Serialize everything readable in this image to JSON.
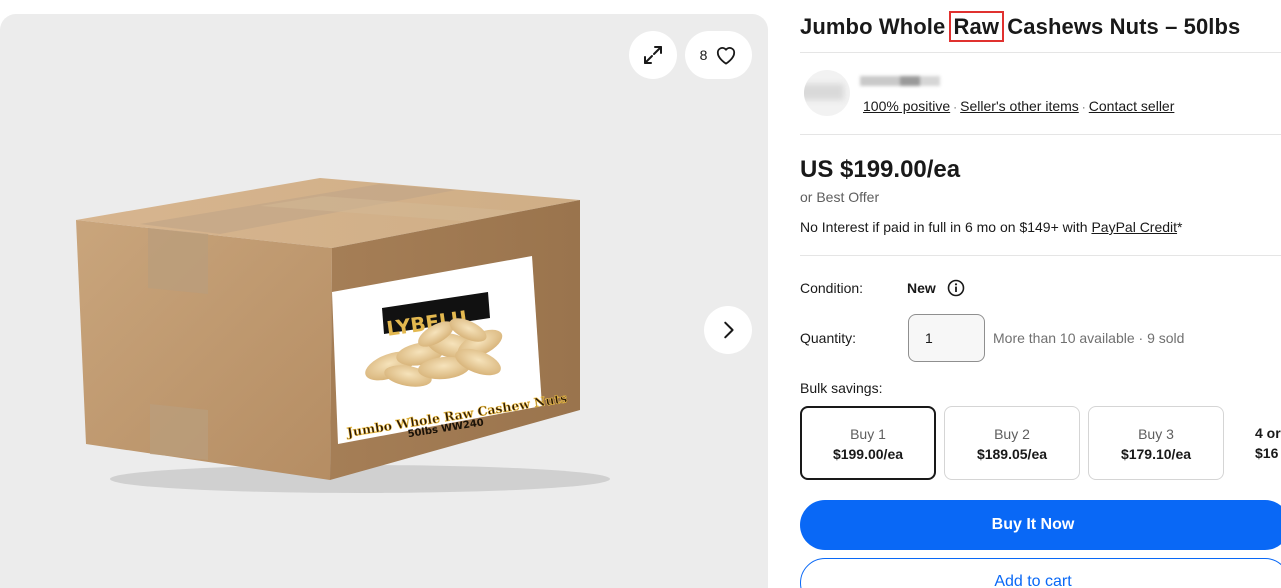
{
  "gallery": {
    "watch_count": "8",
    "icons": {
      "expand": "expand-icon",
      "watch": "heart-icon",
      "next": "chevron-right-icon"
    },
    "product_image": {
      "brand": "LYBELU",
      "label_line1": "Jumbo Whole Raw Cashew Nuts",
      "label_line2": "50lbs WW240"
    }
  },
  "listing": {
    "title_before": "Jumbo Whole ",
    "title_highlight": "Raw",
    "title_after": " Cashews Nuts – 50lbs"
  },
  "seller": {
    "feedback": "100% positive",
    "other_items": "Seller's other items",
    "contact": "Contact seller"
  },
  "pricing": {
    "price": "US $199.00/ea",
    "best_offer": "or Best Offer",
    "financing_text": "No Interest if paid in full in 6 mo on $149+ with ",
    "financing_link": "PayPal Credit",
    "financing_suffix": "*"
  },
  "condition": {
    "label": "Condition:",
    "value": "New",
    "info_icon": "info-icon"
  },
  "quantity": {
    "label": "Quantity:",
    "value": "1",
    "availability": "More than 10 available · 9 sold"
  },
  "bulk": {
    "label": "Bulk savings:",
    "options": [
      {
        "qty": "Buy 1",
        "price": "$199.00/ea",
        "selected": true
      },
      {
        "qty": "Buy 2",
        "price": "$189.05/ea",
        "selected": false
      },
      {
        "qty": "Buy 3",
        "price": "$179.10/ea",
        "selected": false
      },
      {
        "qty": "4 or",
        "price": "$16",
        "selected": false
      }
    ]
  },
  "actions": {
    "buy_now": "Buy It Now",
    "add_to_cart": "Add to cart"
  },
  "colors": {
    "primary_blue": "#0968f6",
    "highlight_box": "#e0312f",
    "gallery_bg": "#ececec"
  }
}
